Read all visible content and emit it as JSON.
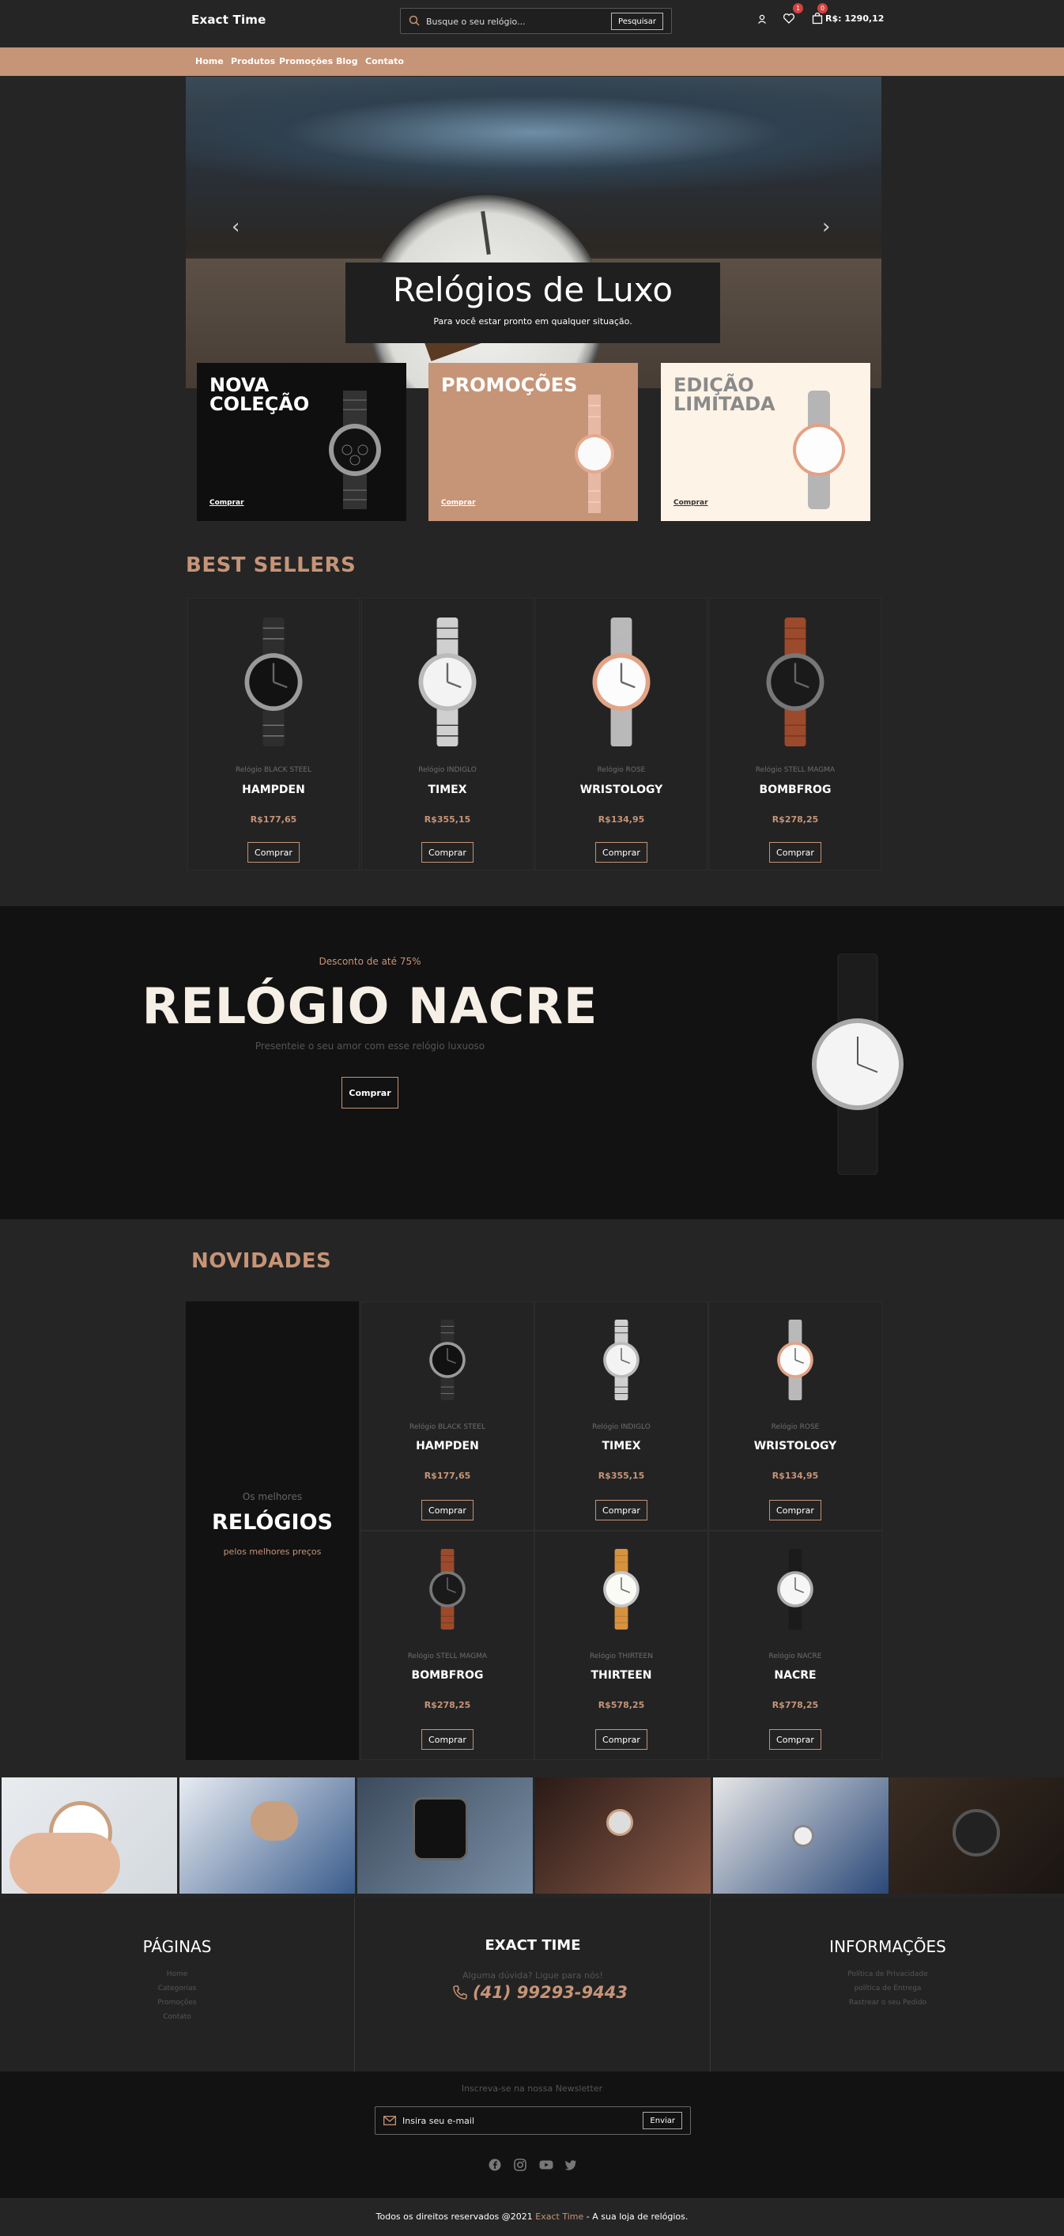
{
  "header": {
    "brand": "Exact Time",
    "search_placeholder": "Busque o seu relógio...",
    "search_button": "Pesquisar",
    "wishlist_count": "1",
    "cart_count": "0",
    "cart_total": "R$: 1290,12"
  },
  "nav": [
    "Home",
    "Produtos",
    "Promoções",
    "Blog",
    "Contato"
  ],
  "hero": {
    "title": "Relógios de Luxo",
    "subtitle": "Para você estar pronto em qualquer situação.",
    "prev_icon": "chevron-left-icon",
    "next_icon": "chevron-right-icon"
  },
  "promo_cards": [
    {
      "title_line1": "NOVA",
      "title_line2": "COLEÇÃO",
      "link": "Comprar",
      "bg": "#0f0f0f",
      "text_color": "#ffffff"
    },
    {
      "title_line1": "PROMOÇÕES",
      "title_line2": "",
      "link": "Comprar",
      "bg": "#c69477",
      "text_color": "#ffffff"
    },
    {
      "title_line1": "EDIÇÃO",
      "title_line2": "LIMITADA",
      "link": "Comprar",
      "bg": "#fdf3e7",
      "text_color": "#8a8a8a"
    }
  ],
  "best_sellers": {
    "title": "BEST SELLERS",
    "products": [
      {
        "sub": "Relógio BLACK STEEL",
        "name": "HAMPDEN",
        "price": "R$177,65",
        "button": "Comprar"
      },
      {
        "sub": "Relógio INDIGLO",
        "name": "TIMEX",
        "price": "R$355,15",
        "button": "Comprar"
      },
      {
        "sub": "Relógio ROSE",
        "name": "WRISTOLOGY",
        "price": "R$134,95",
        "button": "Comprar"
      },
      {
        "sub": "Relógio STELL MAGMA",
        "name": "BOMBFROG",
        "price": "R$278,25",
        "button": "Comprar"
      }
    ]
  },
  "banner": {
    "discount": "Desconto de até 75%",
    "title": "RELÓGIO NACRE",
    "subtitle": "Presenteie o seu amor com esse relógio luxuoso",
    "button": "Comprar"
  },
  "novidades": {
    "title": "NOVIDADES",
    "side_top": "Os melhores",
    "side_main": "RELÓGIOS",
    "side_bottom": "pelos melhores preços",
    "products": [
      {
        "sub": "Relógio BLACK STEEL",
        "name": "HAMPDEN",
        "price": "R$177,65",
        "button": "Comprar"
      },
      {
        "sub": "Relógio INDIGLO",
        "name": "TIMEX",
        "price": "R$355,15",
        "button": "Comprar"
      },
      {
        "sub": "Relógio ROSE",
        "name": "WRISTOLOGY",
        "price": "R$134,95",
        "button": "Comprar"
      },
      {
        "sub": "Relógio STELL MAGMA",
        "name": "BOMBFROG",
        "price": "R$278,25",
        "button": "Comprar"
      },
      {
        "sub": "Relógio THIRTEEN",
        "name": "THIRTEEN",
        "price": "R$578,25",
        "button": "Comprar"
      },
      {
        "sub": "Relógio NACRE",
        "name": "NACRE",
        "price": "R$778,25",
        "button": "Comprar"
      }
    ]
  },
  "footer": {
    "pages_title": "PÁGINAS",
    "pages_links": [
      "Home",
      "Categorias",
      "Promoções",
      "Contato"
    ],
    "center_title": "EXACT TIME",
    "center_sub": "Alguma dúvida? Ligue para nós!",
    "phone": "(41) 99293-9443",
    "info_title": "INFORMAÇÕES",
    "info_links": [
      "Política de Privacidade",
      "política de Entrega",
      "Rastrear o seu Pedido"
    ]
  },
  "newsletter": {
    "title": "Inscreva-se na nossa Newsletter",
    "placeholder": "Insira seu e-mail",
    "button": "Enviar"
  },
  "social_icons": [
    "facebook-icon",
    "instagram-icon",
    "youtube-icon",
    "twitter-icon"
  ],
  "copyright": {
    "before": "Todos os direitos reservados @2021 ",
    "brand": "Exact Time",
    "after": " - A sua loja de relógios."
  },
  "colors": {
    "accent": "#c69477",
    "background": "#252525",
    "dark": "#121212",
    "badge": "#d34141"
  }
}
